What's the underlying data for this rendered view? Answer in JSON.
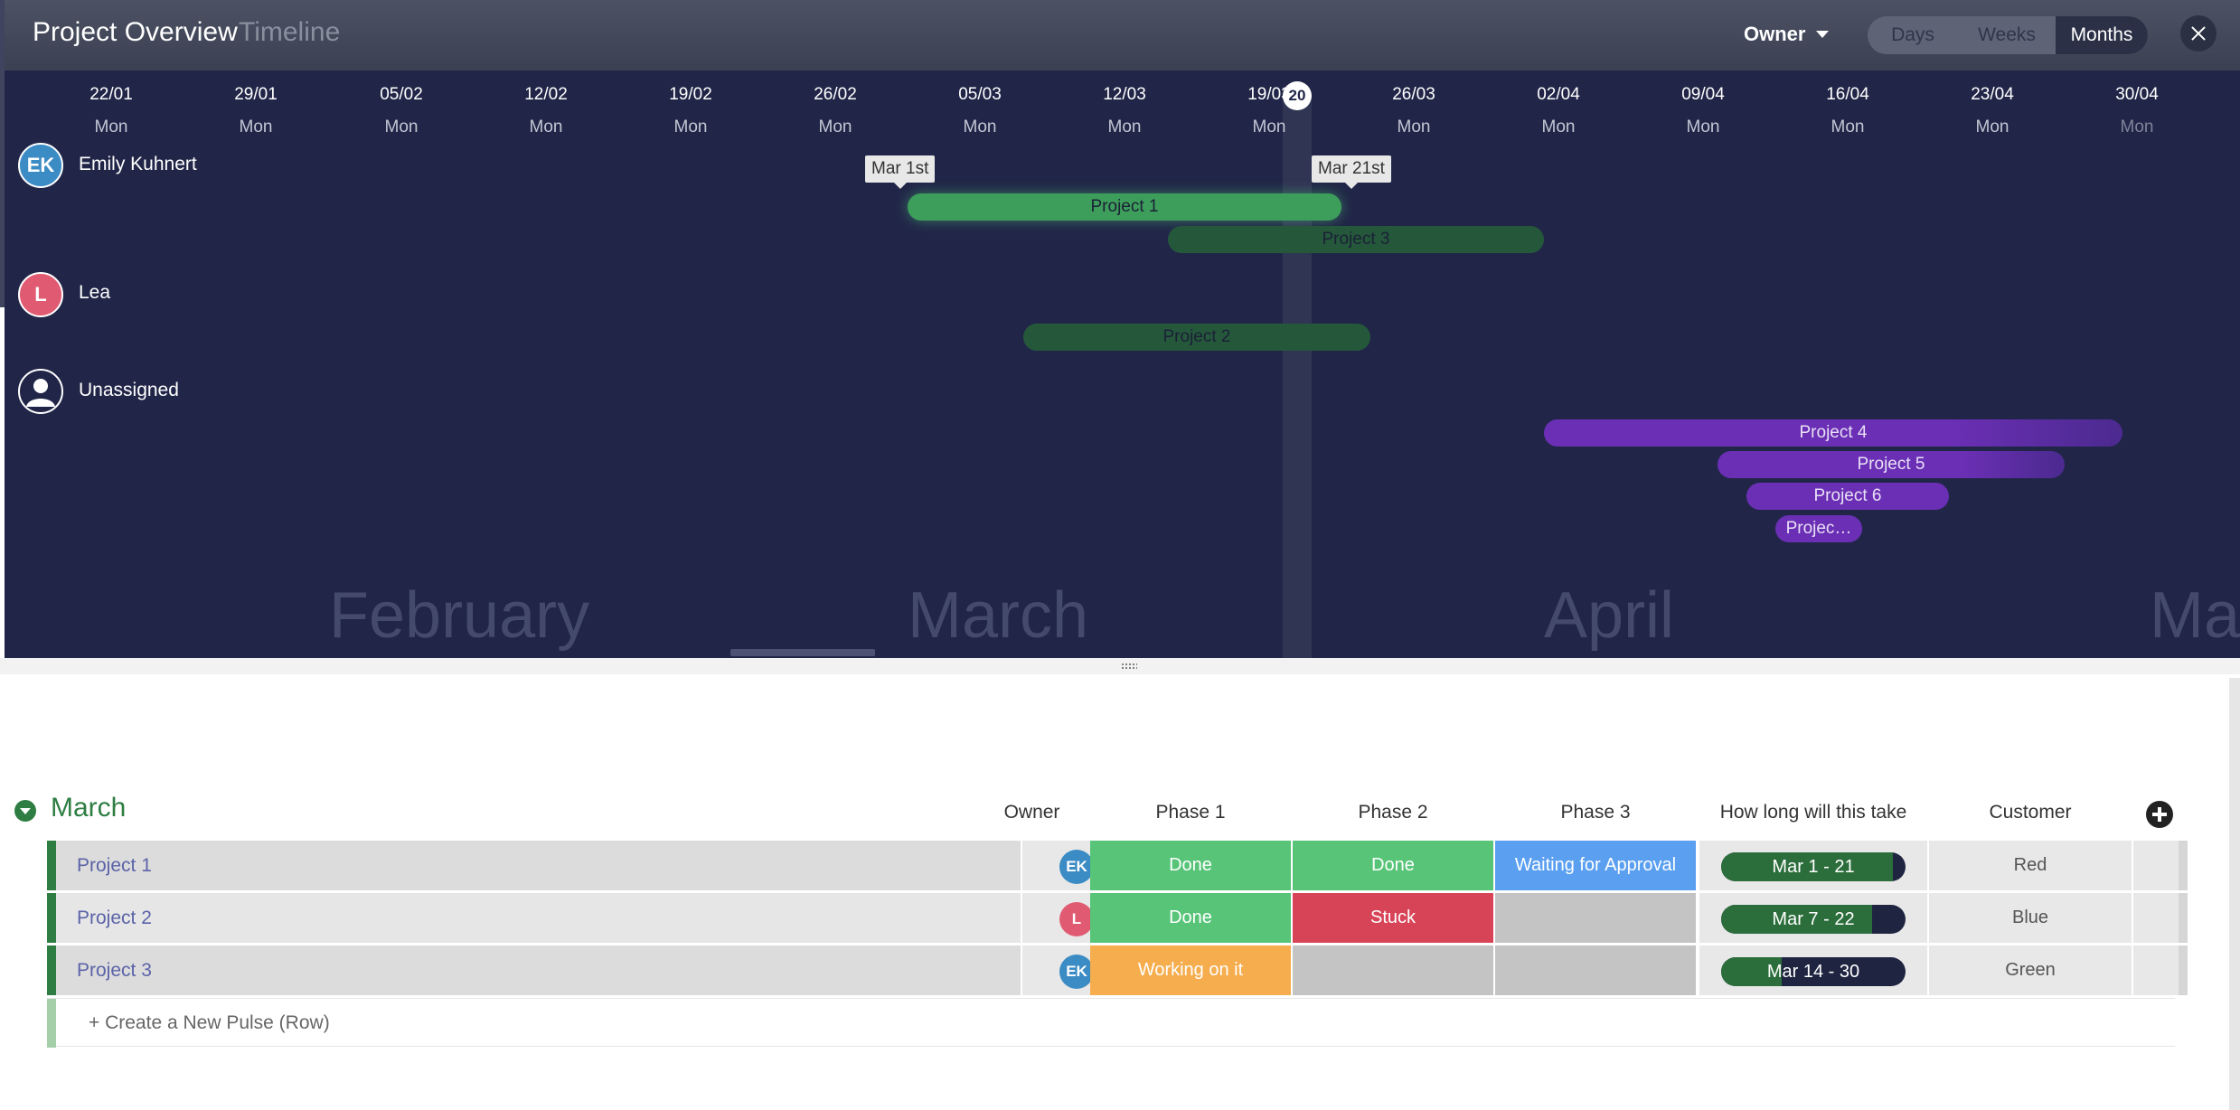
{
  "header": {
    "title": "Project Overview",
    "subtitle": "Timeline",
    "group_by": "Owner",
    "zoom_options": [
      "Days",
      "Weeks",
      "Months"
    ],
    "zoom_selected": "Months"
  },
  "timeline": {
    "dates": [
      {
        "date": "22/01",
        "weekday": "Mon"
      },
      {
        "date": "29/01",
        "weekday": "Mon"
      },
      {
        "date": "05/02",
        "weekday": "Mon"
      },
      {
        "date": "12/02",
        "weekday": "Mon"
      },
      {
        "date": "19/02",
        "weekday": "Mon"
      },
      {
        "date": "26/02",
        "weekday": "Mon"
      },
      {
        "date": "05/03",
        "weekday": "Mon"
      },
      {
        "date": "12/03",
        "weekday": "Mon"
      },
      {
        "date": "19/03",
        "weekday": "Mon"
      },
      {
        "date": "26/03",
        "weekday": "Mon"
      },
      {
        "date": "02/04",
        "weekday": "Mon"
      },
      {
        "date": "09/04",
        "weekday": "Mon"
      },
      {
        "date": "16/04",
        "weekday": "Mon"
      },
      {
        "date": "23/04",
        "weekday": "Mon"
      },
      {
        "date": "30/04",
        "weekday": "Mon"
      }
    ],
    "today": "20",
    "months": [
      "February",
      "March",
      "April",
      "Ma"
    ],
    "owners": [
      {
        "initials": "EK",
        "name": "Emily Kuhnert",
        "color": "#3b8bc4"
      },
      {
        "initials": "L",
        "name": "Lea",
        "color": "#e05a72"
      },
      {
        "initials": "",
        "name": "Unassigned",
        "color": "#212648"
      }
    ],
    "tooltips": [
      "Mar 1st",
      "Mar 21st"
    ],
    "bars": [
      {
        "label": "Project 1",
        "owner": "Emily Kuhnert"
      },
      {
        "label": "Project 3",
        "owner": "Emily Kuhnert"
      },
      {
        "label": "Project 2",
        "owner": "Lea"
      },
      {
        "label": "Project 4",
        "owner": "Unassigned"
      },
      {
        "label": "Project 5",
        "owner": "Unassigned"
      },
      {
        "label": "Project 6",
        "owner": "Unassigned"
      },
      {
        "label": "Projec…",
        "owner": "Unassigned"
      }
    ]
  },
  "board": {
    "group_title": "March",
    "columns": [
      "Owner",
      "Phase 1",
      "Phase 2",
      "Phase 3",
      "How long will this take",
      "Customer"
    ],
    "rows": [
      {
        "name": "Project 1",
        "owner_initials": "EK",
        "owner_color": "#3b8bc4",
        "phase1": {
          "text": "Done",
          "color": "#57c478"
        },
        "phase2": {
          "text": "Done",
          "color": "#57c478"
        },
        "phase3": {
          "text": "Waiting for Approval",
          "color": "#5a9ff0"
        },
        "duration": "Mar 1 - 21",
        "duration_progress": 0.93,
        "customer": "Red"
      },
      {
        "name": "Project 2",
        "owner_initials": "L",
        "owner_color": "#e05a72",
        "phase1": {
          "text": "Done",
          "color": "#57c478"
        },
        "phase2": {
          "text": "Stuck",
          "color": "#d84457"
        },
        "phase3": {
          "text": "",
          "color": "#c4c4c4"
        },
        "duration": "Mar 7 - 22",
        "duration_progress": 0.82,
        "customer": "Blue"
      },
      {
        "name": "Project 3",
        "owner_initials": "EK",
        "owner_color": "#3b8bc4",
        "phase1": {
          "text": "Working on it",
          "color": "#f5ad4e"
        },
        "phase2": {
          "text": "",
          "color": "#c4c4c4"
        },
        "phase3": {
          "text": "",
          "color": "#c4c4c4"
        },
        "duration": "Mar 14 - 30",
        "duration_progress": 0.33,
        "customer": "Green"
      }
    ],
    "new_row_label": "+ Create a New Pulse (Row)"
  }
}
